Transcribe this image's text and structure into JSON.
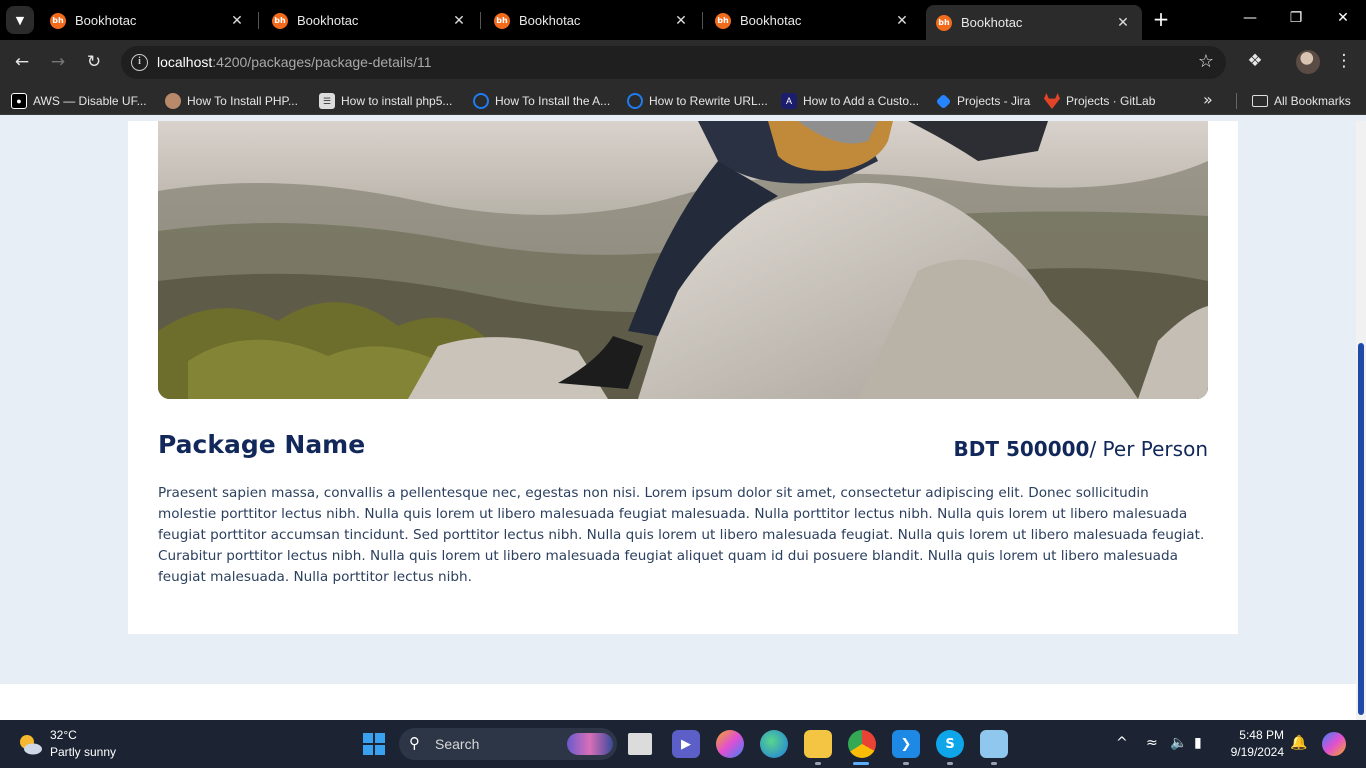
{
  "browser": {
    "tabs": [
      {
        "title": "Bookhotac",
        "favicon": "bh"
      },
      {
        "title": "Bookhotac",
        "favicon": "bh"
      },
      {
        "title": "Bookhotac",
        "favicon": "bh"
      },
      {
        "title": "Bookhotac",
        "favicon": "bh"
      },
      {
        "title": "Bookhotac",
        "favicon": "bh"
      }
    ],
    "active_tab_index": 4,
    "url_host": "localhost",
    "url_rest": ":4200/packages/package-details/11",
    "bookmarks": [
      {
        "label": "AWS — Disable UF...",
        "icon": "medium-icon",
        "color": "#ffffff"
      },
      {
        "label": "How To Install PHP...",
        "icon": "avatar-icon",
        "color": "#b98a6a"
      },
      {
        "label": "How to install php5...",
        "icon": "page-icon",
        "color": "#dcdcdc"
      },
      {
        "label": "How To Install the A...",
        "icon": "digitalocean-icon",
        "color": "#1f7cf0"
      },
      {
        "label": "How to Rewrite URL...",
        "icon": "digitalocean-icon",
        "color": "#1f7cf0"
      },
      {
        "label": "How to Add a Custo...",
        "icon": "angular-icon",
        "color": "#1d1d6e"
      },
      {
        "label": "Projects - Jira",
        "icon": "jira-icon",
        "color": "#2684ff"
      },
      {
        "label": "Projects · GitLab",
        "icon": "gitlab-icon",
        "color": "#e24329"
      }
    ],
    "all_bookmarks_label": "All Bookmarks"
  },
  "package": {
    "name": "Package Name",
    "price_amount": "BDT 500000",
    "price_unit": "/ Per Person",
    "description": "Praesent sapien massa, convallis a pellentesque nec, egestas non nisi. Lorem ipsum dolor sit amet, consectetur adipiscing elit. Donec sollicitudin molestie porttitor lectus nibh. Nulla quis lorem ut libero malesuada feugiat malesuada. Nulla porttitor lectus nibh. Nulla quis lorem ut libero malesuada feugiat porttitor accumsan tincidunt. Sed porttitor lectus nibh. Nulla quis lorem ut libero malesuada feugiat. Nulla quis lorem ut libero malesuada feugiat. Curabitur porttitor lectus nibh. Nulla quis lorem ut libero malesuada feugiat aliquet quam id dui posuere blandit. Nulla quis lorem ut libero malesuada feugiat malesuada. Nulla porttitor lectus nibh.",
    "image_alt": "hiker-sitting-on-rocks"
  },
  "colors": {
    "heading": "#12285a",
    "page_bg": "#e8eef6",
    "scroll_thumb": "#1f4aa8"
  },
  "taskbar": {
    "weather_temp": "32°C",
    "weather_desc": "Partly sunny",
    "search_label": "Search",
    "time": "5:48 PM",
    "date": "9/19/2024"
  }
}
